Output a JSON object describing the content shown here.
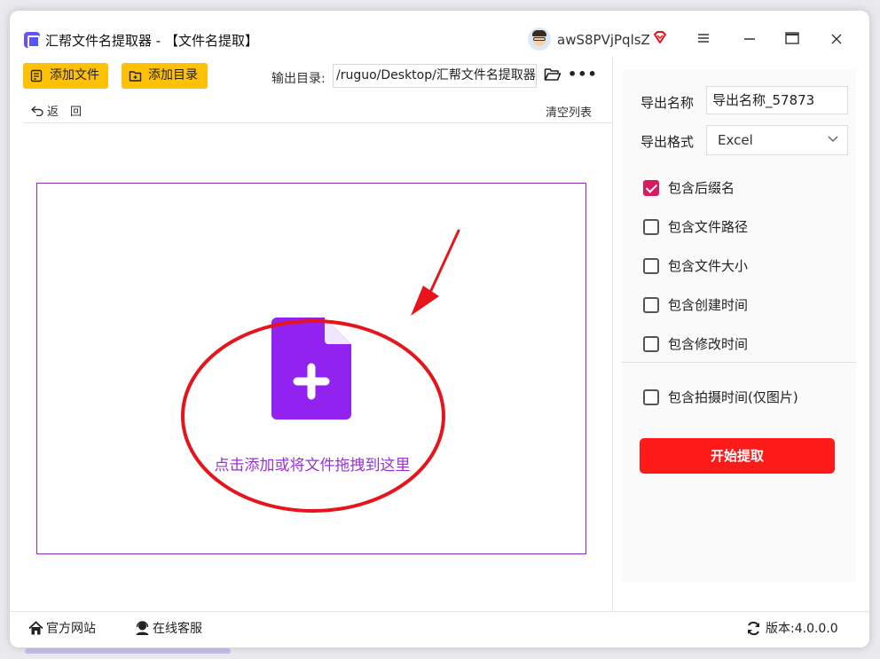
{
  "app": {
    "title": "汇帮文件名提取器 - 【文件名提取】",
    "username": "awS8PVjPqlsZ"
  },
  "window_controls": [
    "menu-icon",
    "minimize-icon",
    "maximize-icon",
    "close-icon"
  ],
  "toolbar": {
    "add_file_label": "添加文件",
    "add_dir_label": "添加目录",
    "output_dir_label": "输出目录:",
    "output_dir_value": "/ruguo/Desktop/汇帮文件名提取器",
    "more_label": "•••",
    "back_label": "返　回",
    "clear_label": "清空列表"
  },
  "dropzone": {
    "hint": "点击添加或将文件拖拽到这里"
  },
  "side_panel": {
    "export_name_label": "导出名称",
    "export_name_value": "导出名称_57873",
    "export_format_label": "导出格式",
    "export_format_value": "Excel",
    "options": [
      {
        "label": "包含后缀名",
        "checked": true
      },
      {
        "label": "包含文件路径",
        "checked": false
      },
      {
        "label": "包含文件大小",
        "checked": false
      },
      {
        "label": "包含创建时间",
        "checked": false
      },
      {
        "label": "包含修改时间",
        "checked": false
      },
      {
        "label": "包含拍摄时间(仅图片)",
        "checked": false
      }
    ],
    "start_label": "开始提取"
  },
  "footer": {
    "site_label": "官方网站",
    "service_label": "在线客服",
    "version_label": "版本:4.0.0.0"
  },
  "colors": {
    "toolbar_button": "#ffc107",
    "start_button": "#ff1a1a",
    "accent_purple": "#9b30d9",
    "annotation_red": "#e8141c",
    "checkbox_checked": "#d81b60"
  }
}
